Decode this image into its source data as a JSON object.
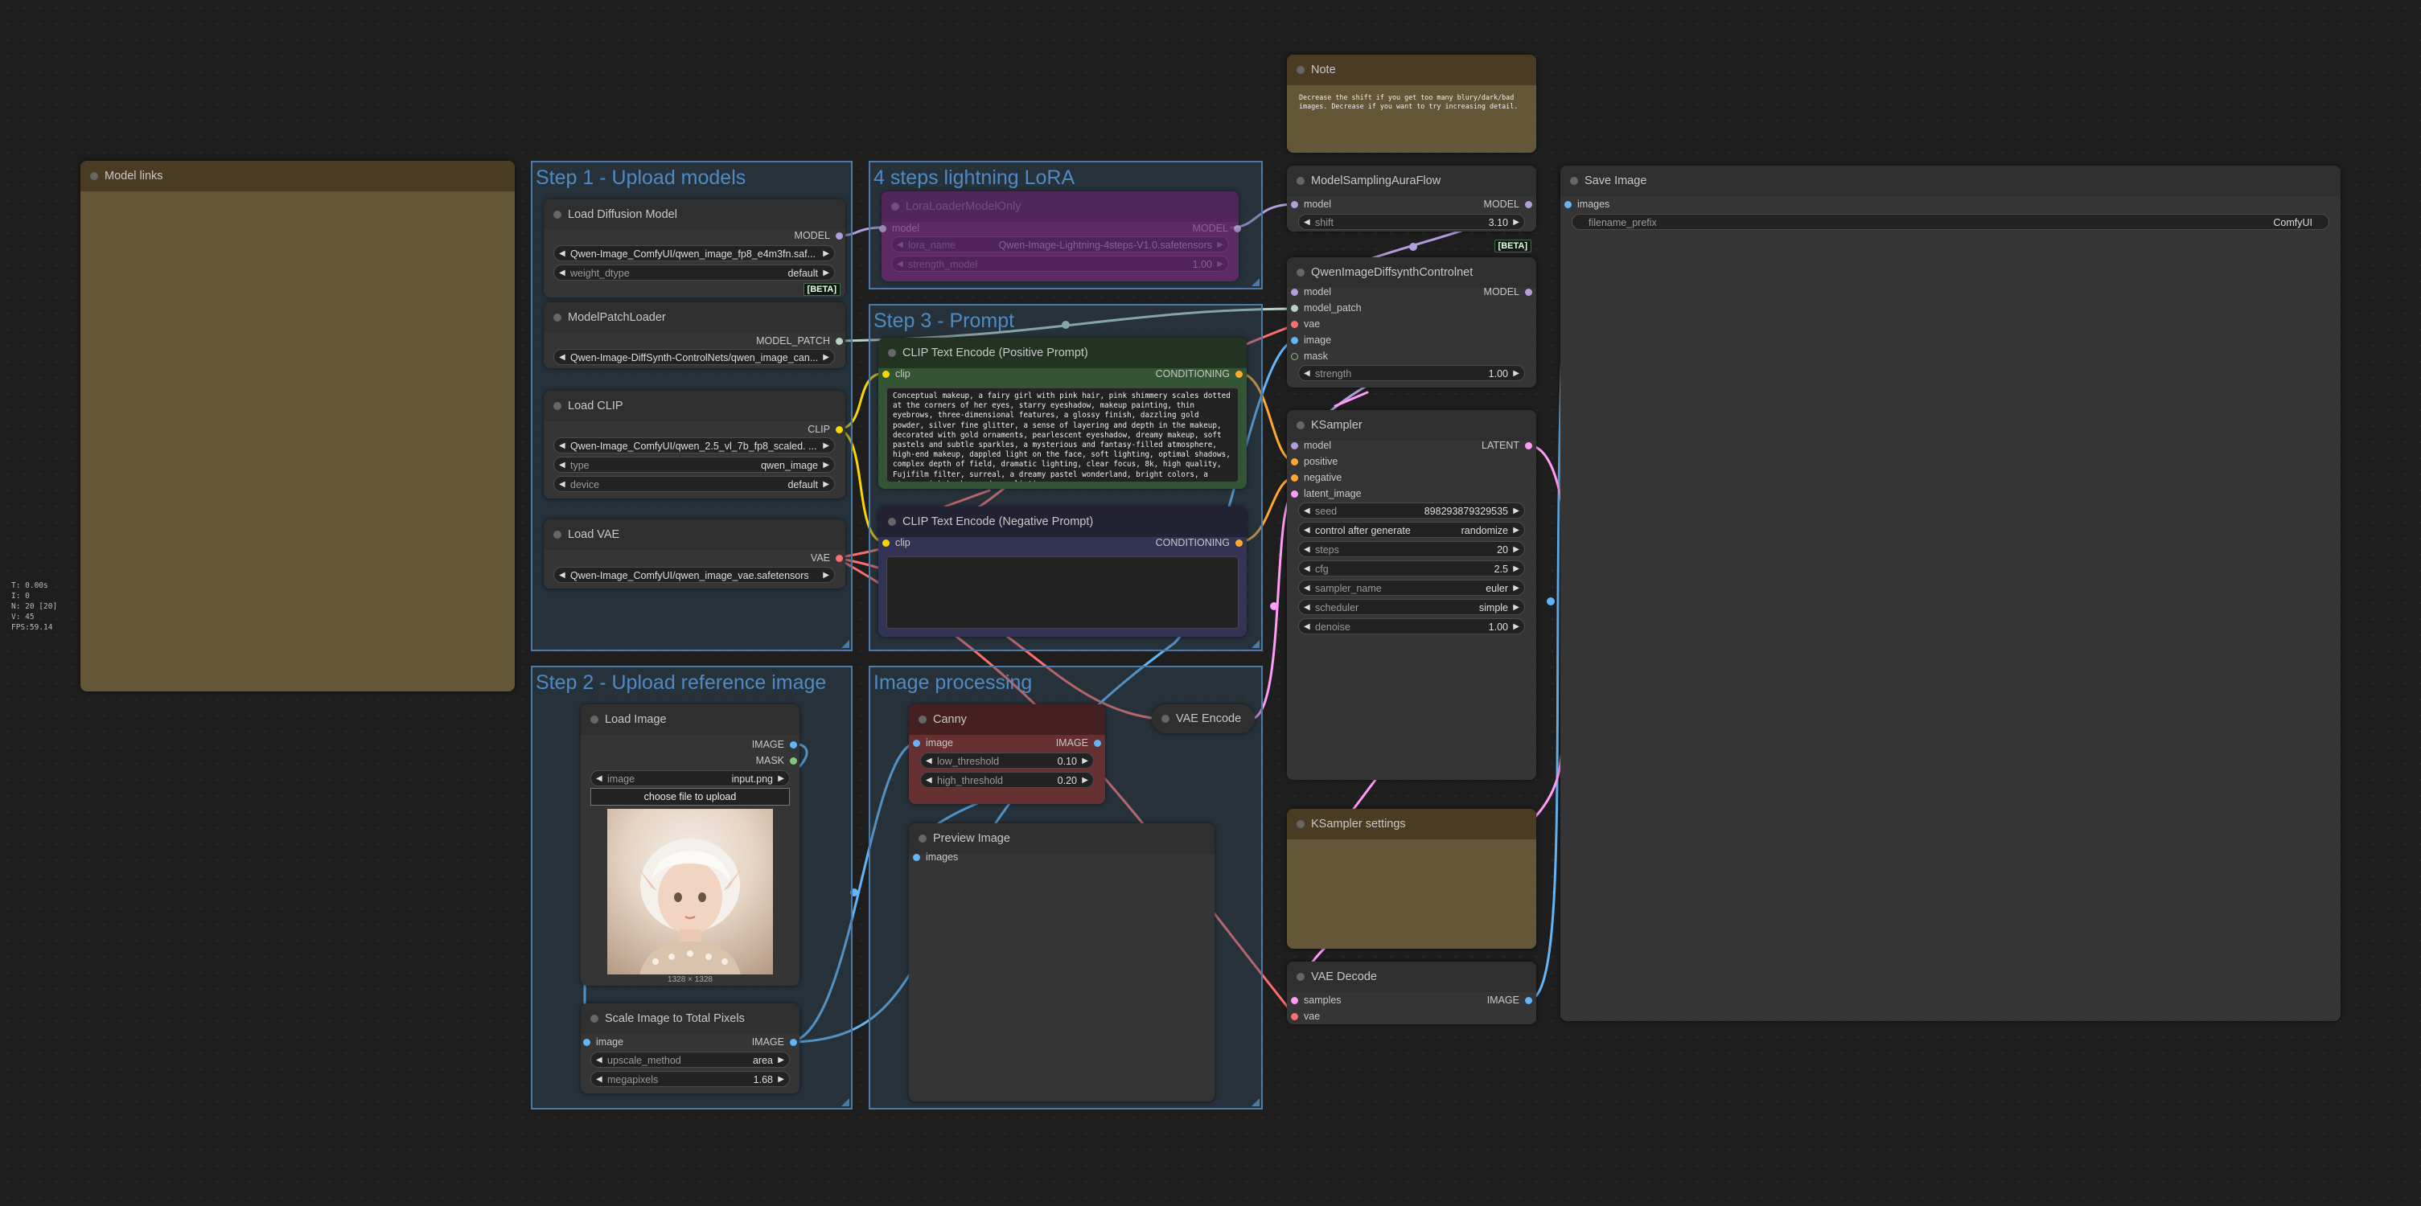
{
  "colors": {
    "canvas": "#1e1e1e",
    "group_fill": "#2e4a60",
    "group_title": "#4f8ac5",
    "node_body": "#353535",
    "note_body": "#635737",
    "clip_wire": "#ffd500",
    "model_wire": "#b39ddb",
    "vae_wire": "#ff6e6e",
    "conditioning_wire": "#ffa931",
    "image_wire": "#64b5f6",
    "latent_wire": "#ff9cf9",
    "model_patch_wire": "#b5d3c4",
    "mask_wire": "#81c784"
  },
  "stats": [
    "T: 0.00s",
    "I: 0",
    "N: 20 [20]",
    "V: 45",
    "FPS:59.14"
  ],
  "groups": {
    "step1": {
      "title": "Step 1 - Upload models"
    },
    "lora": {
      "title": "4 steps lightning LoRA"
    },
    "step3": {
      "title": "Step 3 - Prompt"
    },
    "step2": {
      "title": "Step 2 - Upload reference image"
    },
    "imgproc": {
      "title": "Image processing"
    }
  },
  "nodes": {
    "model_links": {
      "title": "Model links"
    },
    "load_diffusion": {
      "title": "Load Diffusion Model",
      "out_model": "MODEL",
      "unet_name": "Qwen-Image_ComfyUI/qwen_image_fp8_e4m3fn.saf...",
      "weight_dtype_label": "weight_dtype",
      "weight_dtype": "default",
      "badge": "[BETA]"
    },
    "model_patch_loader": {
      "title": "ModelPatchLoader",
      "out": "MODEL_PATCH",
      "name": "Qwen-Image-DiffSynth-ControlNets/qwen_image_can..."
    },
    "load_clip": {
      "title": "Load CLIP",
      "out": "CLIP",
      "clip_name": "Qwen-Image_ComfyUI/qwen_2.5_vl_7b_fp8_scaled. ...",
      "type_label": "type",
      "type": "qwen_image",
      "device_label": "device",
      "device": "default"
    },
    "load_vae": {
      "title": "Load VAE",
      "out": "VAE",
      "vae_name": "Qwen-Image_ComfyUI/qwen_image_vae.safetensors"
    },
    "lora": {
      "title": "LoraLoaderModelOnly",
      "in_model": "model",
      "out_model": "MODEL",
      "lora_label": "lora_name",
      "lora_name": "Qwen-Image-Lightning-4steps-V1.0.safetensors",
      "strength_label": "strength_model",
      "strength": "1.00"
    },
    "clip_pos": {
      "title": "CLIP Text Encode (Positive Prompt)",
      "in": "clip",
      "out": "CONDITIONING",
      "text": "Conceptual makeup, a fairy girl with pink hair, pink shimmery scales dotted at the corners of her eyes, starry eyeshadow, makeup painting, thin eyebrows, three-dimensional features, a glossy finish, dazzling gold powder, silver fine glitter, a sense of layering and depth in the makeup, decorated with gold ornaments, pearlescent eyeshadow, dreamy makeup, soft pastels and subtle sparkles, a mysterious and fantasy-filled atmosphere, high-end makeup, dappled light on the face, soft lighting, optimal shadows, complex depth of field, dramatic lighting, clear focus, 8k, high quality, Fujifilm filter, surreal, a dreamy pastel wonderland, bright colors, a starry pink background, realistic."
    },
    "clip_neg": {
      "title": "CLIP Text Encode (Negative Prompt)",
      "in": "clip",
      "out": "CONDITIONING",
      "text": ""
    },
    "load_image": {
      "title": "Load Image",
      "out_image": "IMAGE",
      "out_mask": "MASK",
      "image_label": "image",
      "image": "input.png",
      "upload": "choose file to upload",
      "dims": "1328 × 1328"
    },
    "scale_image": {
      "title": "Scale Image to Total Pixels",
      "in": "image",
      "out": "IMAGE",
      "method_label": "upscale_method",
      "method": "area",
      "mp_label": "megapixels",
      "megapixels": "1.68"
    },
    "canny": {
      "title": "Canny",
      "in": "image",
      "out": "IMAGE",
      "low_label": "low_threshold",
      "low": "0.10",
      "high_label": "high_threshold",
      "high": "0.20"
    },
    "preview": {
      "title": "Preview Image",
      "in": "images"
    },
    "vae_encode": {
      "title": "VAE Encode"
    },
    "note": {
      "title": "Note",
      "text": "Decrease the shift if you get too many blury/dark/bad images. Decrease if you want to try increasing detail."
    },
    "msaf": {
      "title": "ModelSamplingAuraFlow",
      "in": "model",
      "out": "MODEL",
      "shift_label": "shift",
      "shift": "3.10",
      "badge": "[BETA]"
    },
    "diffsynth": {
      "title": "QwenImageDiffsynthControlnet",
      "in_model": "model",
      "in_patch": "model_patch",
      "in_vae": "vae",
      "in_image": "image",
      "in_mask": "mask",
      "out": "MODEL",
      "strength_label": "strength",
      "strength": "1.00"
    },
    "ksampler": {
      "title": "KSampler",
      "in_model": "model",
      "in_pos": "positive",
      "in_neg": "negative",
      "in_latent": "latent_image",
      "out": "LATENT",
      "widgets": [
        {
          "label": "seed",
          "value": "898293879329535"
        },
        {
          "label": "control after generate",
          "value": "randomize"
        },
        {
          "label": "steps",
          "value": "20"
        },
        {
          "label": "cfg",
          "value": "2.5"
        },
        {
          "label": "sampler_name",
          "value": "euler"
        },
        {
          "label": "scheduler",
          "value": "simple"
        },
        {
          "label": "denoise",
          "value": "1.00"
        }
      ]
    },
    "ks_settings": {
      "title": "KSampler settings"
    },
    "vae_decode": {
      "title": "VAE Decode",
      "in_samples": "samples",
      "in_vae": "vae",
      "out": "IMAGE"
    },
    "save_image": {
      "title": "Save Image",
      "in": "images",
      "prefix_label": "filename_prefix",
      "prefix": "ComfyUI"
    }
  }
}
